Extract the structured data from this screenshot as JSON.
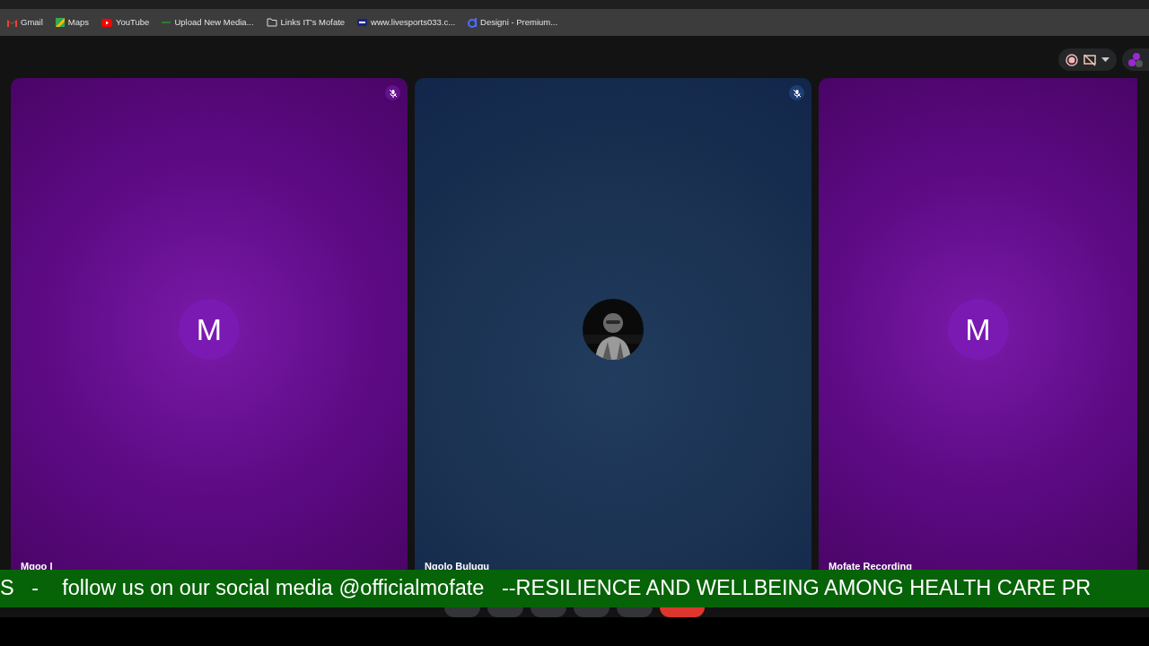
{
  "bookmarks": [
    {
      "label": "Gmail"
    },
    {
      "label": "Maps"
    },
    {
      "label": "YouTube"
    },
    {
      "label": "Upload New Media..."
    },
    {
      "label": "Links IT's Mofate"
    },
    {
      "label": "www.livesports033.c..."
    },
    {
      "label": "Designi - Premium..."
    }
  ],
  "recording": {
    "on": true
  },
  "tiles": [
    {
      "name": "Mgoo I",
      "kind": "letter",
      "initial": "M",
      "muted": true
    },
    {
      "name": "Ngolo Bulugu",
      "muted": true
    },
    {
      "name": "Mofate Recording",
      "kind": "letter",
      "initial": "M"
    }
  ],
  "ticker": {
    "text": "S   -    follow us on our social media @officialmofate   --RESILIENCE AND WELLBEING AMONG HEALTH CARE PR"
  }
}
